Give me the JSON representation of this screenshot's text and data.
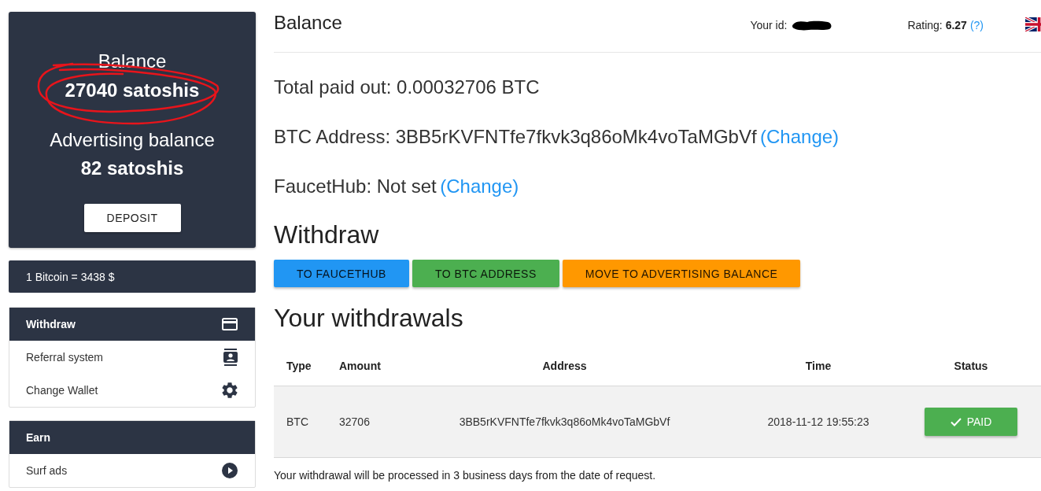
{
  "sidebar": {
    "balance_card": {
      "balance_label": "Balance",
      "balance_value": "27040 satoshis",
      "ad_balance_label": "Advertising balance",
      "ad_balance_value": "82 satoshis",
      "button": "DEPOSIT"
    },
    "rate": "1 Bitcoin = 3438 $",
    "menus": [
      {
        "title": "Withdraw",
        "items": [
          "Referral system",
          "Change Wallet"
        ]
      },
      {
        "title": "Earn",
        "items": [
          "Surf ads"
        ]
      }
    ]
  },
  "header": {
    "title": "Balance",
    "your_id_label": "Your id:",
    "rating": "Rating: **6.27**",
    "rating_help": "(?)"
  },
  "summary": [
    {
      "text": "Total paid out: 0.00032706 BTC"
    },
    {
      "text": "BTC Address: 3BB5rKVFNTfe7fkvk3q86oMk4voTaMGbVf",
      "link": "(Change)"
    },
    {
      "text": "FaucetHub: Not set",
      "link": "(Change)"
    }
  ],
  "withdraw": {
    "title": "Withdraw",
    "buttons": [
      {
        "label": "TO FAUCETHUB",
        "color": "#2196f3"
      },
      {
        "label": "TO BTC ADDRESS",
        "color": "#4caf50"
      },
      {
        "label": "MOVE TO ADVERTISING BALANCE",
        "color": "#ff9800"
      }
    ]
  },
  "withdrawals": {
    "title": "Your withdrawals",
    "columns": [
      "Type",
      "Amount",
      "Address",
      "Time",
      "Status"
    ],
    "rows": [
      {
        "type": "BTC",
        "amount": "32706",
        "address": "3BB5rKVFNTfe7fkvk3q86oMk4voTaMGbVf",
        "time": "2018-11-12 19:55:23",
        "status": "PAID"
      }
    ]
  },
  "note": "Your withdrawal will be processed in 3 business days from the date of request."
}
